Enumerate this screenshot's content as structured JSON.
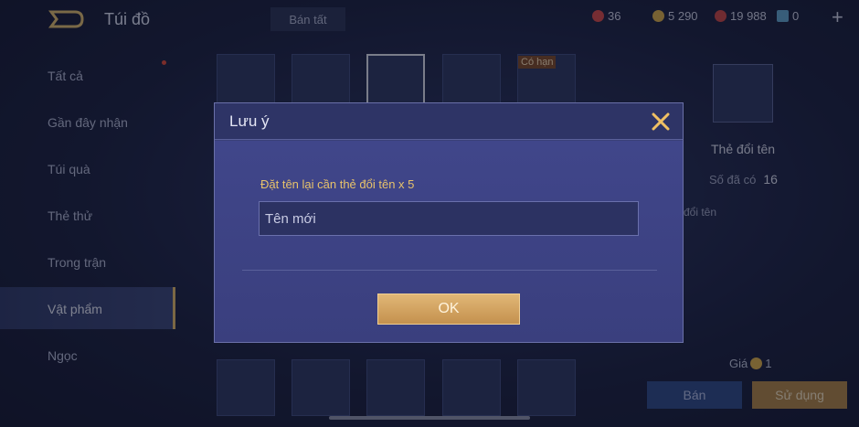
{
  "header": {
    "title": "Túi đồ",
    "sell_all": "Bán tất",
    "currencies": [
      {
        "icon": "red-gem-icon",
        "value": "36",
        "color": "#d04a4a"
      },
      {
        "icon": "gold-coin-icon",
        "value": "5 290",
        "color": "#d4a94a"
      },
      {
        "icon": "red-voucher-icon",
        "value": "19 988",
        "color": "#c44646"
      },
      {
        "icon": "card-icon",
        "value": "0",
        "color": "#5fa0c8"
      }
    ],
    "add_icon": "plus-icon"
  },
  "sidebar": {
    "items": [
      {
        "label": "Tất cả"
      },
      {
        "label": "Gần đây nhận"
      },
      {
        "label": "Túi quà"
      },
      {
        "label": "Thẻ thử"
      },
      {
        "label": "Trong trận"
      },
      {
        "label": "Vật phẩm"
      },
      {
        "label": "Ngọc"
      }
    ],
    "active": "Vật phẩm"
  },
  "grid": {
    "tag": "Có hạn"
  },
  "detail": {
    "name": "Thẻ đổi tên",
    "owned_label": "Số đã có",
    "owned_value": "16",
    "description": "đổi tên",
    "price_label": "Giá",
    "price_value": "1",
    "sell_button": "Bán",
    "use_button": "Sử dụng"
  },
  "dialog": {
    "title": "Lưu ý",
    "message": "Đặt tên lại cần thẻ đổi tên x 5",
    "input_placeholder": "Tên mới",
    "ok_button": "OK"
  }
}
